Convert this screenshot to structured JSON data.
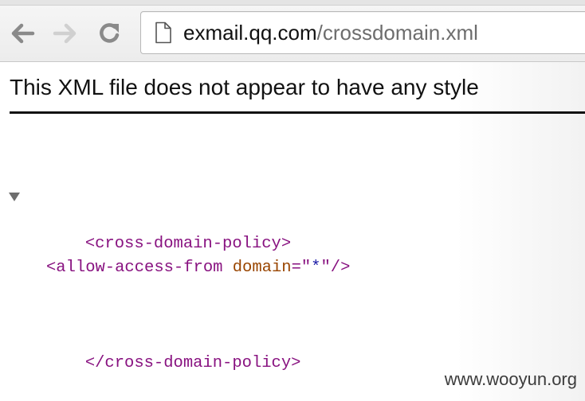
{
  "browser": {
    "url_host": "exmail.qq.com",
    "url_path": "/crossdomain.xml",
    "back_icon": "arrow-left-icon",
    "forward_icon": "arrow-right-icon",
    "reload_icon": "reload-icon",
    "page_icon": "document-icon"
  },
  "page": {
    "notice": "This XML file does not appear to have any style"
  },
  "xml": {
    "line1": {
      "open": "<cross-domain-policy>"
    },
    "line2": {
      "tag_start": "<allow-access-from ",
      "attr_name": "domain",
      "equals_quote": "=\"",
      "attr_value": "*",
      "close_quote": "\"",
      "tag_end": "/>"
    },
    "line3": {
      "close": "</cross-domain-policy>"
    }
  },
  "watermark": "www.wooyun.org",
  "colors": {
    "tag": "#881280",
    "attr_name": "#994500",
    "attr_value": "#1a1aa6"
  }
}
